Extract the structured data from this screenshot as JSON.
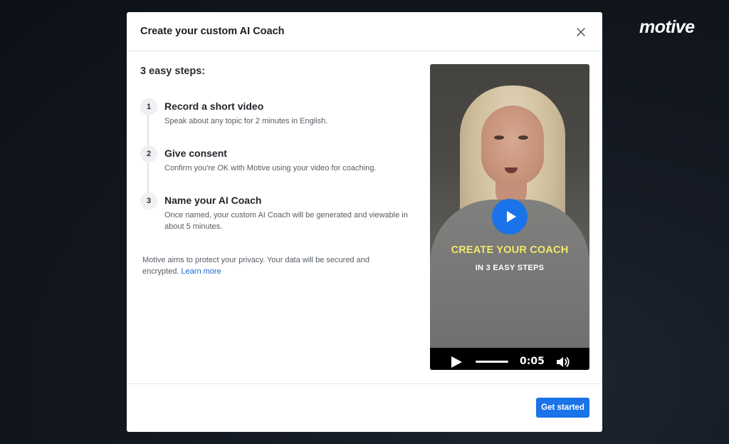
{
  "brand": {
    "logo_text": "motive"
  },
  "modal": {
    "title": "Create your custom AI Coach",
    "close_icon": "close-icon",
    "steps_heading": "3 easy steps:",
    "steps": [
      {
        "number": "1",
        "title": "Record a short video",
        "description": "Speak about any topic for 2 minutes in English."
      },
      {
        "number": "2",
        "title": "Give consent",
        "description": "Confirm you're OK with Motive using your video for coaching."
      },
      {
        "number": "3",
        "title": "Name your AI Coach",
        "description": "Once named, your custom AI Coach will be generated and viewable in about 5 minutes."
      }
    ],
    "privacy": {
      "text": "Motive aims to protect your privacy. Your data will be secured and encrypted.",
      "link_label": "Learn more"
    },
    "video": {
      "overlay_title": "CREATE YOUR COACH",
      "overlay_subtitle": "IN 3 EASY STEPS",
      "time": "0:05",
      "accent_color": "#f3e768",
      "play_color": "#1a73e8"
    },
    "footer": {
      "primary_label": "Get started"
    }
  },
  "colors": {
    "primary": "#1a73e8",
    "link": "#1a66d2"
  }
}
